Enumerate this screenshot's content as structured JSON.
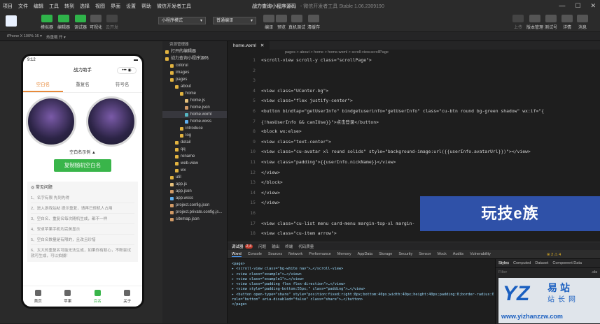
{
  "menu": [
    "项目",
    "文件",
    "编辑",
    "工具",
    "转到",
    "选择",
    "视图",
    "界面",
    "设置",
    "帮助",
    "微信开发者工具"
  ],
  "window": {
    "title": "战力查询小程序源码",
    "version": "- 微信开发者工具 Stable 1.06.2309190"
  },
  "toolbar": {
    "simulator": "模拟器",
    "editor": "编辑器",
    "debugger": "调试器",
    "visual": "可视化",
    "cloud": "云开发",
    "mode_select": "小程序模式",
    "compile_select": "普通编译",
    "compile": "编译",
    "preview": "预览",
    "real_debug": "真机调试",
    "clear_cache": "清缓存",
    "upload": "上传",
    "version_mgmt": "版本管理",
    "test_id": "测试号",
    "detail": "详情",
    "message": "消息"
  },
  "subbar": {
    "device": "iPhone X 100% 16 ▾",
    "hotreload": "热重载 开 ▾"
  },
  "phone": {
    "time": "9:12",
    "nav_title": "战力助手",
    "tabs": [
      "空白名",
      "重复名",
      "符号名"
    ],
    "example_caption": "空白名示例 ▲",
    "copy_button": "复制随机空白名",
    "faq_title": "常见问题",
    "faq": [
      "1、名字有限 先到先得",
      "2、进入游戏站帖 提示重复，请再已修机人占用",
      "3、空白名、重复名每次随机生成，都不一样",
      "4、安卓苹果手机均完美显示",
      "5、空白名数量是有限的，且改且珍惜",
      "6、太大的重复名可能无法生成，如果你有耐心，不断尝试就可生成，可以拍摄！"
    ],
    "tabbar": [
      "首页",
      "苹果",
      "百名",
      "关于"
    ]
  },
  "explorer": {
    "header": "资源管理器",
    "items": [
      {
        "label": "打开的编辑器",
        "indent": 0
      },
      {
        "label": "战力查询小程序源码",
        "indent": 0
      },
      {
        "label": "colorui",
        "indent": 1
      },
      {
        "label": "images",
        "indent": 1
      },
      {
        "label": "pages",
        "indent": 1
      },
      {
        "label": "about",
        "indent": 2
      },
      {
        "label": "home",
        "indent": 3
      },
      {
        "label": "home.js",
        "indent": 4
      },
      {
        "label": "home.json",
        "indent": 4
      },
      {
        "label": "home.wxml",
        "indent": 4
      },
      {
        "label": "home.wxss",
        "indent": 4
      },
      {
        "label": "introduce",
        "indent": 3
      },
      {
        "label": "log",
        "indent": 3
      },
      {
        "label": "detail",
        "indent": 2
      },
      {
        "label": "qq",
        "indent": 2
      },
      {
        "label": "rename",
        "indent": 2
      },
      {
        "label": "web-view",
        "indent": 2
      },
      {
        "label": "wx",
        "indent": 2
      },
      {
        "label": "util",
        "indent": 1
      },
      {
        "label": "app.js",
        "indent": 1
      },
      {
        "label": "app.json",
        "indent": 1
      },
      {
        "label": "app.wxss",
        "indent": 1
      },
      {
        "label": "project.config.json",
        "indent": 1
      },
      {
        "label": "project.private.config.js...",
        "indent": 1
      },
      {
        "label": "sitemap.json",
        "indent": 1
      }
    ]
  },
  "editor": {
    "tab": "home.wxml",
    "breadcrumb": "pages > about > home > home.wxml > scroll-view.scrollPage",
    "banner": "玩技e族"
  },
  "code": [
    "<scroll-view scroll-y class=\"scrollPage\">",
    "",
    "",
    "  <view class=\"UCenter-bg\">",
    "    <view class=\"flex justify-center\">",
    "      <button bindtap=\"getUserInfo\" bindgetuserinfo=\"getUserInfo\" class=\"cu-btn round bg-green shadow\" wx:if=\"{",
    "      {!hasUserInfo && canIUse}}\">点击登录</button>",
    "      <block wx:else>",
    "        <view class=\"text-center\">",
    "          <view class=\"cu-avatar xl round solids\" style=\"background-image:url({{userInfo.avatarUrl}})\"></view>",
    "          <view class=\"padding\">{{userInfo.nickName}}</view>",
    "        </view>",
    "      </block>",
    "    </view>",
    "  </view>",
    "",
    "  <view class=\"cu-list menu card-menu margin-top-xl margin-",
    "    <view class=\"cu-item arrow\">",
    "      <view class=\"content\" bindtap=\"goDetailPage\" data-pa",
    "        <text class=\"cuIcon-appreciatefill text-green\"></text>"
  ],
  "debug": {
    "tabs1": [
      "调试器",
      "问题",
      "输出",
      "终端",
      "代码质量"
    ],
    "badge": "2,4",
    "tabs2": [
      "Wxml",
      "Console",
      "Sources",
      "Network",
      "Performance",
      "Memory",
      "AppData",
      "Storage",
      "Security",
      "Sensor",
      "Mock",
      "Audits",
      "Vulnerability"
    ],
    "status": "⊗ 2  ⚠ 4",
    "dom": [
      "<page>",
      "  ▸ <scroll-view class=\"bg-white nav\">…</scroll-view>",
      "  ▸ <view class=\"example\">…</view>",
      "  ▸ <view class=\"example1\">…</view>",
      "  ▸ <view class=\"padding flex flex-direction\">…</view>",
      "  ▸ <view style=\"padding-bottom:55px;\" class=\"padding\">…</view>",
      "  ▸ <button open-type=\"share\" style=\"position:fixed;right:8px;bottom:40px;width:40px;height:40px;padding:0;border-radius:0;\"",
      "  role=\"button\" aria-disabled=\"false\" class=\"share\">…</button>",
      "</page>"
    ],
    "styles_tabs": [
      "Styles",
      "Computed",
      "Dataset",
      "Component Data"
    ],
    "filter": "Filter",
    ".cls": ".cls"
  },
  "watermark": {
    "logo": "YZ",
    "t1": "易站",
    "t2": "站长网",
    "url": "www.yizhanzzw.com"
  }
}
